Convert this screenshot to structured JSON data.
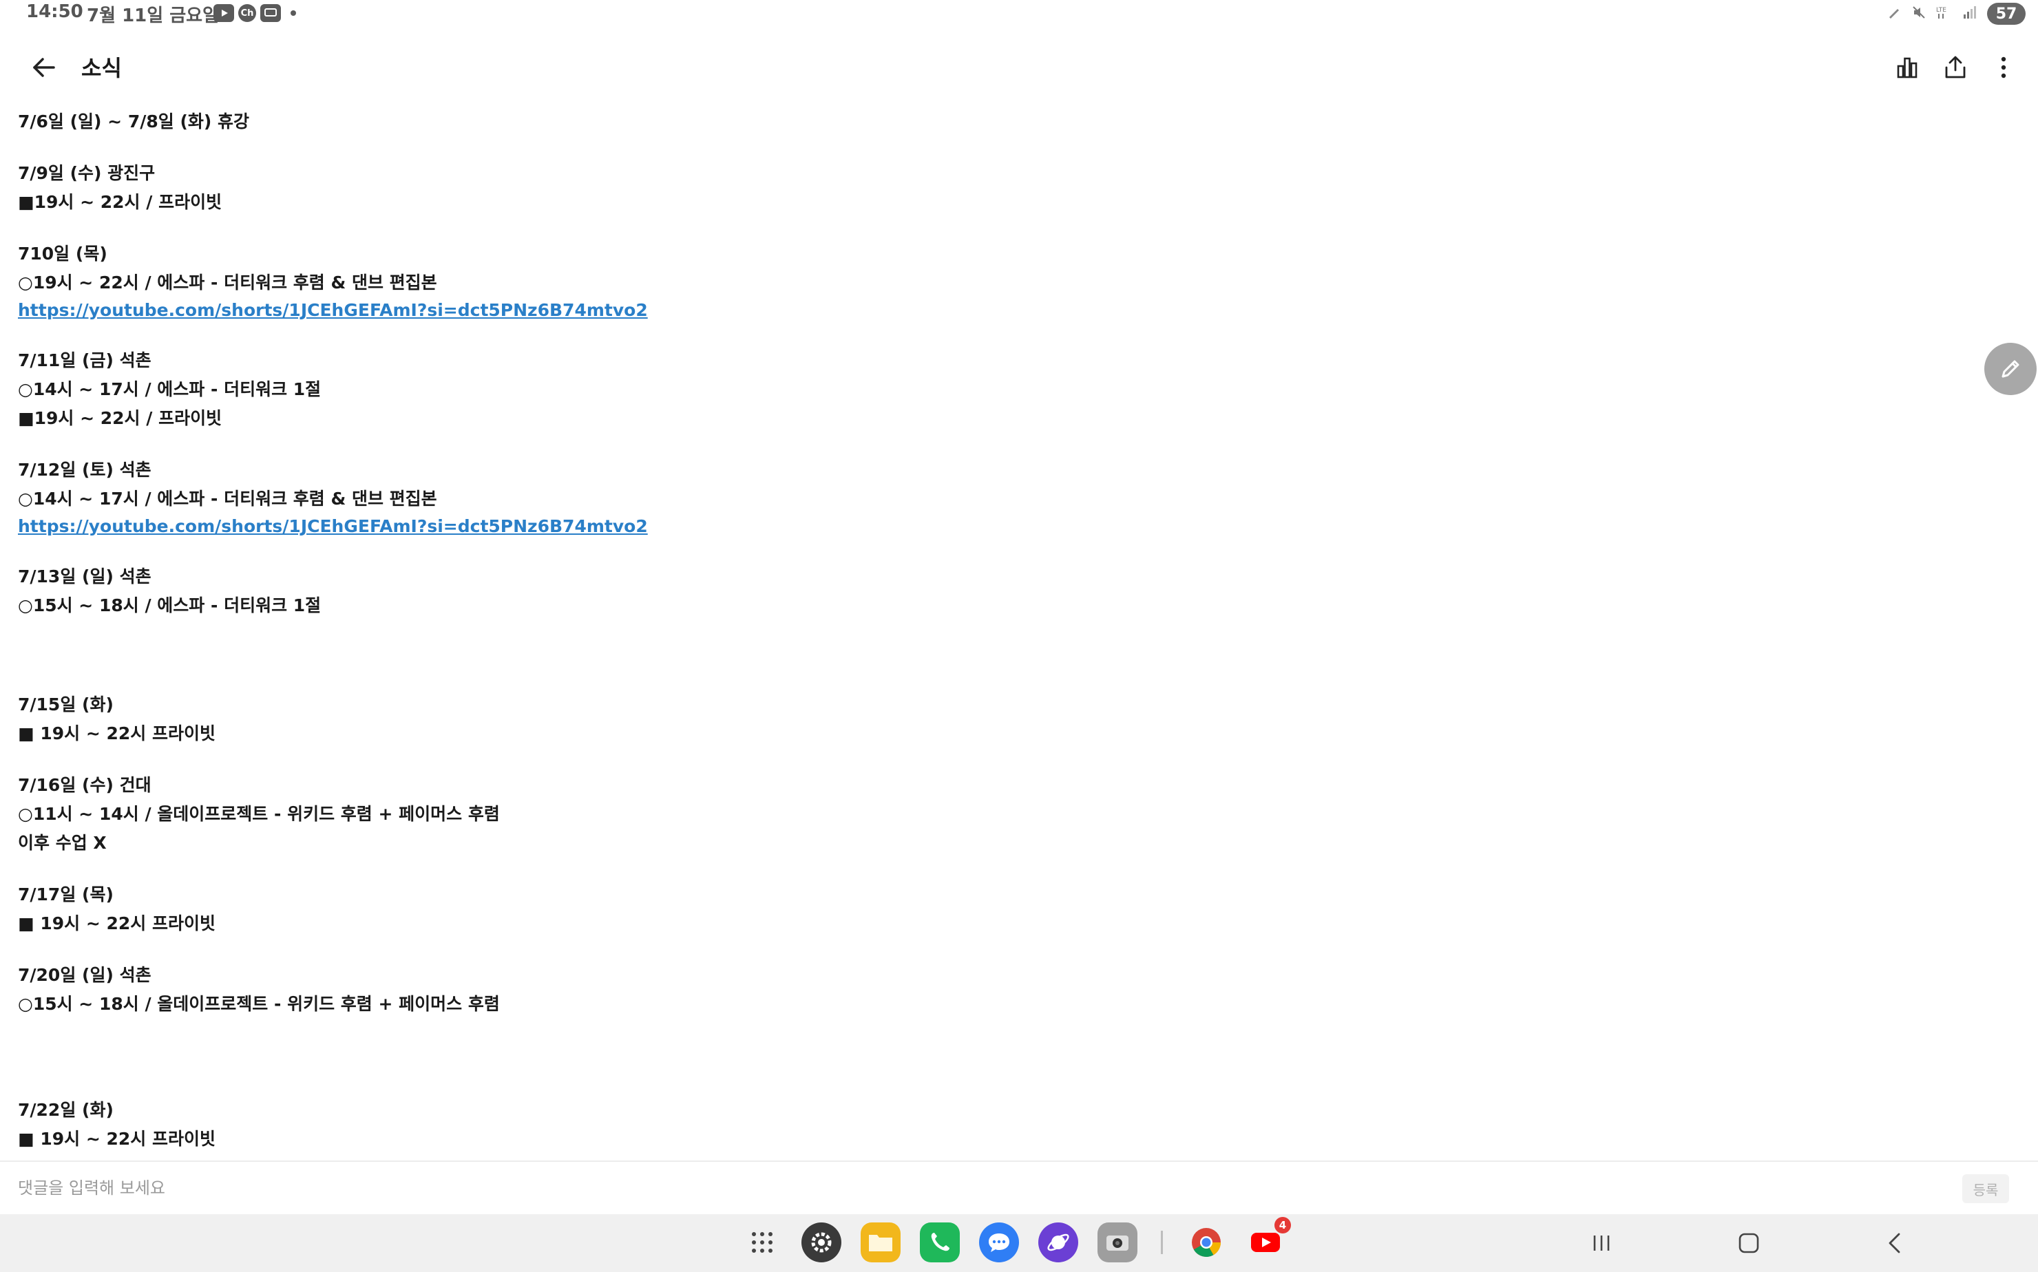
{
  "status_bar": {
    "time": "14:50",
    "date": "7월 11일 금요일",
    "notif_icons": [
      "youtube-icon",
      "chzzk-icon",
      "messenger-icon"
    ],
    "battery": "57"
  },
  "app_bar": {
    "title": "소식"
  },
  "post": {
    "lines": [
      {
        "text": "7/6일 (일) ~ 7/8일 (화) 휴강",
        "type": "text"
      },
      {
        "type": "gap1"
      },
      {
        "text": "7/9일 (수) 광진구",
        "type": "text"
      },
      {
        "text": "■19시 ~ 22시 / 프라이빗",
        "type": "text"
      },
      {
        "type": "gap1"
      },
      {
        "text": "710일 (목)",
        "type": "text"
      },
      {
        "text": "○19시 ~ 22시 / 에스파 - 더티워크 후렴 & 댄브 편집본",
        "type": "text"
      },
      {
        "text": "https://youtube.com/shorts/1JCEhGEFAmI?si=dct5PNz6B74mtvo2",
        "type": "link"
      },
      {
        "type": "gap1"
      },
      {
        "text": "7/11일 (금) 석촌",
        "type": "text"
      },
      {
        "text": "○14시 ~ 17시 / 에스파 - 더티워크 1절",
        "type": "text"
      },
      {
        "text": "■19시 ~ 22시 / 프라이빗",
        "type": "text"
      },
      {
        "type": "gap1"
      },
      {
        "text": "7/12일 (토) 석촌",
        "type": "text"
      },
      {
        "text": "○14시 ~ 17시 / 에스파 - 더티워크 후렴 & 댄브 편집본",
        "type": "text"
      },
      {
        "text": "https://youtube.com/shorts/1JCEhGEFAmI?si=dct5PNz6B74mtvo2",
        "type": "link"
      },
      {
        "type": "gap1"
      },
      {
        "text": "7/13일 (일) 석촌",
        "type": "text"
      },
      {
        "text": "○15시 ~ 18시 / 에스파 - 더티워크 1절",
        "type": "text"
      },
      {
        "type": "gap2"
      },
      {
        "text": "7/15일 (화)",
        "type": "text"
      },
      {
        "text": "■ 19시 ~ 22시 프라이빗",
        "type": "text"
      },
      {
        "type": "gap1"
      },
      {
        "text": "7/16일 (수) 건대",
        "type": "text"
      },
      {
        "text": "○11시 ~ 14시 / 올데이프로젝트 - 위키드 후렴 + 페이머스 후렴",
        "type": "text"
      },
      {
        "text": "이후 수업 X",
        "type": "text"
      },
      {
        "type": "gap1"
      },
      {
        "text": "7/17일 (목)",
        "type": "text"
      },
      {
        "text": "■ 19시 ~ 22시 프라이빗",
        "type": "text"
      },
      {
        "type": "gap1"
      },
      {
        "text": "7/20일 (일) 석촌",
        "type": "text"
      },
      {
        "text": "○15시 ~ 18시 / 올데이프로젝트 - 위키드 후렴 + 페이머스 후렴",
        "type": "text"
      },
      {
        "type": "gap3"
      },
      {
        "text": "7/22일 (화)",
        "type": "text"
      },
      {
        "text": "■ 19시 ~ 22시 프라이빗",
        "type": "text"
      }
    ]
  },
  "comment": {
    "placeholder": "댓글을 입력해 보세요",
    "submit_label": "등록"
  },
  "taskbar": {
    "youtube_badge": "4"
  },
  "colors": {
    "link": "#2a7fc8",
    "text": "#1a1a1a",
    "taskbar_bg": "#f0f0f0"
  }
}
